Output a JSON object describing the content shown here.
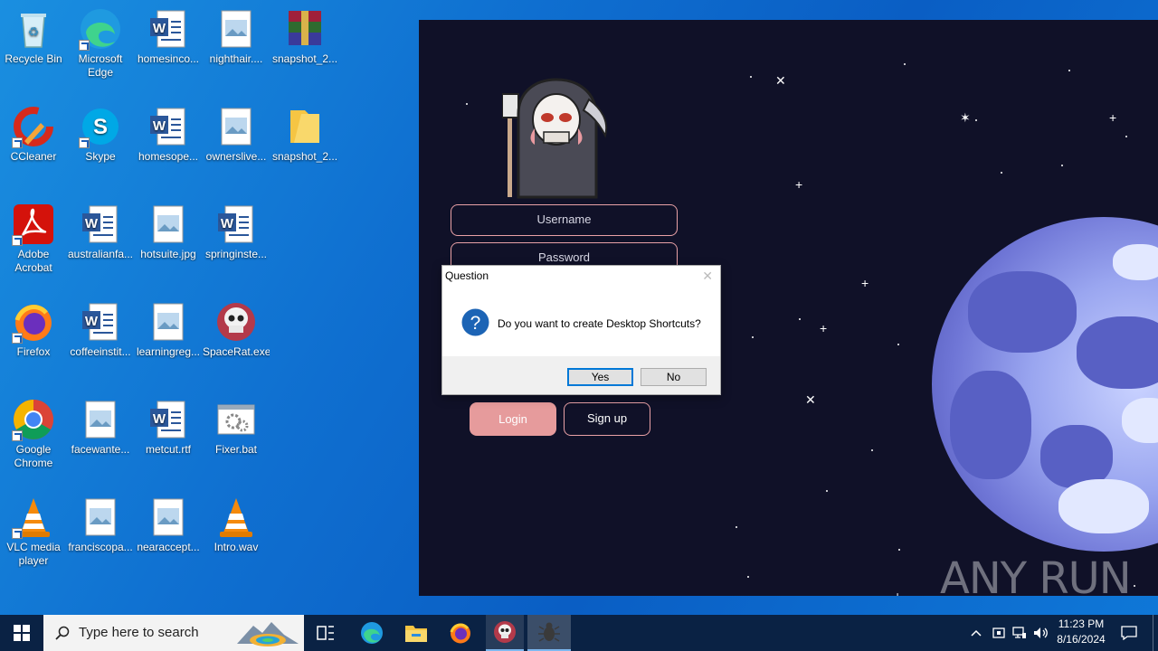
{
  "desktop": {
    "icons": [
      {
        "label": "Recycle Bin"
      },
      {
        "label": "Microsoft Edge"
      },
      {
        "label": "homesinco..."
      },
      {
        "label": "nighthair...."
      },
      {
        "label": "snapshot_2..."
      },
      {
        "label": "CCleaner"
      },
      {
        "label": "Skype"
      },
      {
        "label": "homesope..."
      },
      {
        "label": "ownerslive..."
      },
      {
        "label": "snapshot_2..."
      },
      {
        "label": "Adobe Acrobat"
      },
      {
        "label": "australianfa..."
      },
      {
        "label": "hotsuite.jpg"
      },
      {
        "label": "springinste..."
      },
      {
        "label": "Firefox"
      },
      {
        "label": "coffeeinstit..."
      },
      {
        "label": "learningreg..."
      },
      {
        "label": "SpaceRat.exe"
      },
      {
        "label": "Google Chrome"
      },
      {
        "label": "facewante..."
      },
      {
        "label": "metcut.rtf"
      },
      {
        "label": "Fixer.bat"
      },
      {
        "label": "VLC media player"
      },
      {
        "label": "franciscopa..."
      },
      {
        "label": "nearaccept..."
      },
      {
        "label": "Intro.wav"
      }
    ]
  },
  "app": {
    "username_placeholder": "Username",
    "password_placeholder": "Password",
    "login_label": "Login",
    "signup_label": "Sign up"
  },
  "dialog": {
    "title": "Question",
    "message": "Do you want to create Desktop Shortcuts?",
    "yes_label": "Yes",
    "no_label": "No"
  },
  "watermark": "ANY RUN",
  "taskbar": {
    "search_placeholder": "Type here to search",
    "time": "11:23 PM",
    "date": "8/16/2024"
  },
  "colors": {
    "app_bg": "#101128",
    "accent_pink": "#e69b9c",
    "taskbar": "#0a2244"
  }
}
